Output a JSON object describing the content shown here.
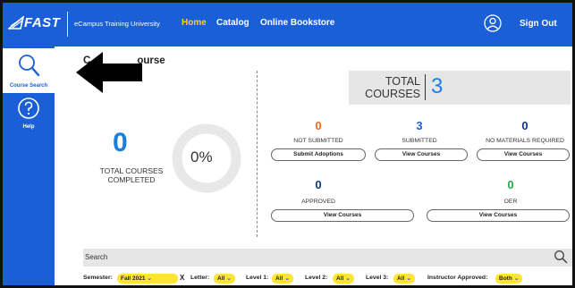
{
  "app": {
    "logo_text": "FAST",
    "university": "eCampus Training University"
  },
  "nav": {
    "items": [
      "Home",
      "Catalog",
      "Online Bookstore"
    ],
    "active": "Home",
    "signout": "Sign Out"
  },
  "sidebar": {
    "items": [
      {
        "label": "Course Search",
        "icon": "magnifier-icon",
        "active": true
      },
      {
        "label": "Help",
        "icon": "question-icon",
        "active": false
      }
    ]
  },
  "main": {
    "heading_left": "C",
    "heading_right": "ourse",
    "completed_count": "0",
    "completed_label": "TOTAL COURSES COMPLETED",
    "completed_percent": "0%",
    "completed_fraction": 0
  },
  "total": {
    "label_line1": "TOTAL",
    "label_line2": "COURSES",
    "count": "3"
  },
  "stats": [
    {
      "value": "0",
      "label": "NOT SUBMITTED",
      "button": "Submit Adoptions",
      "color": "#f06a1a"
    },
    {
      "value": "3",
      "label": "SUBMITTED",
      "button": "View Courses",
      "color": "#1a5fd6"
    },
    {
      "value": "0",
      "label": "NO MATERIALS REQUIRED",
      "button": "View Courses",
      "color": "#0b3a82"
    },
    {
      "value": "0",
      "label": "APPROVED",
      "button": "View Courses",
      "color": "#0b3a82"
    },
    {
      "value": "0",
      "label": "OER",
      "button": "View Courses",
      "color": "#1fae48"
    }
  ],
  "search": {
    "placeholder": "Search"
  },
  "filters": {
    "semester_label": "Semester:",
    "semester_value": "Fall 2021",
    "clear": "X",
    "letter_label": "Letter:",
    "letter_value": "All",
    "level1_label": "Level 1:",
    "level1_value": "All",
    "level2_label": "Level 2:",
    "level2_value": "All",
    "level3_label": "Level 3:",
    "level3_value": "All",
    "instructor_label": "Instructor Approved:",
    "instructor_value": "Both"
  },
  "colors": {
    "brand_blue": "#1a5fd6",
    "accent_yellow": "#ffd21f",
    "stat_blue": "#1a7fe0"
  }
}
